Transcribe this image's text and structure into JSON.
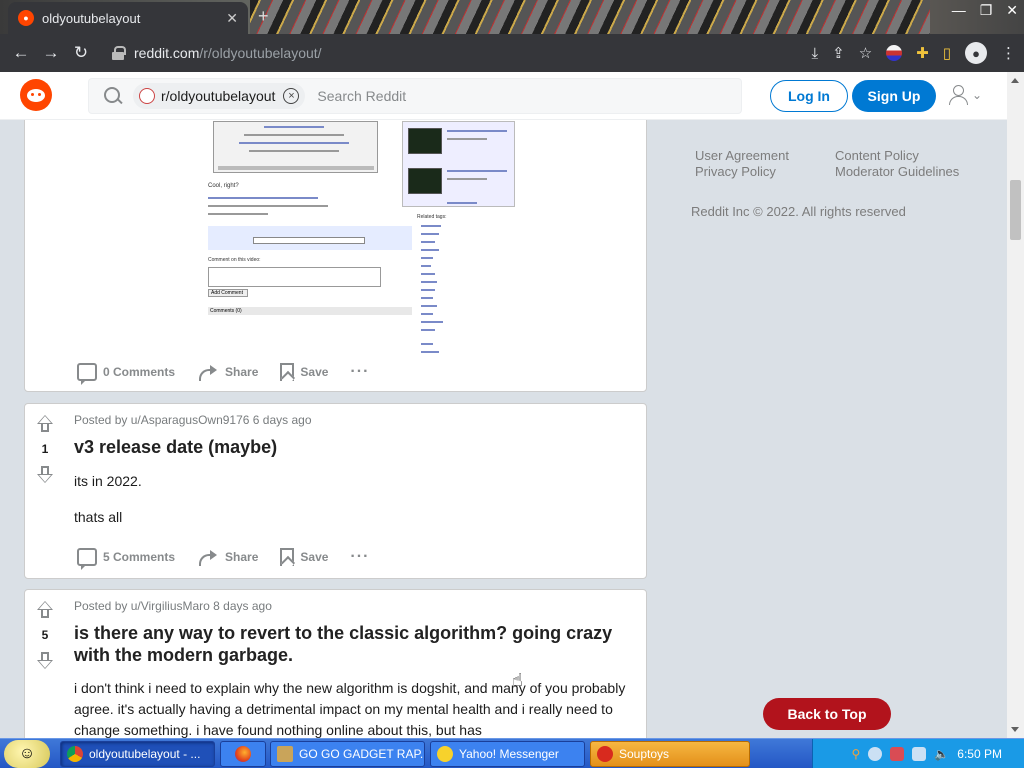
{
  "browser": {
    "tab_title": "oldyoutubelayout",
    "tab_close": "✕",
    "new_tab": "+",
    "url_host": "reddit.com",
    "url_path": "/r/oldyoutubelayout/",
    "nav": {
      "back": "←",
      "forward": "→",
      "reload": "↻"
    },
    "window": {
      "minimize": "—",
      "maximize": "❐",
      "close": "✕"
    },
    "toolbar_icons": {
      "install": "⤓",
      "share": "⇪",
      "bookmark": "☆",
      "extensions": "✚",
      "sidepanel": "▯",
      "menu": "⋮"
    }
  },
  "header": {
    "community_chip": "r/oldyoutubelayout",
    "chip_clear": "×",
    "search_placeholder": "Search Reddit",
    "login": "Log In",
    "signup": "Sign Up",
    "user_caret": "⌄"
  },
  "posts": [
    {
      "comments": "0 Comments",
      "share": "Share",
      "save": "Save",
      "more": "···",
      "screenshot_text": {
        "caption": "Cool, right?",
        "related_header": "Related tags:",
        "comment_label": "Comment on this video:",
        "add_comment": "Add Comment",
        "comments_label": "Comments (0)"
      }
    },
    {
      "score": "1",
      "meta": "Posted by u/AsparagusOwn9176 6 days ago",
      "title": "v3 release date (maybe)",
      "body": [
        "its in 2022.",
        "thats all"
      ],
      "comments": "5 Comments",
      "share": "Share",
      "save": "Save",
      "more": "···"
    },
    {
      "score": "5",
      "meta": "Posted by u/VirgiliusMaro 8 days ago",
      "title": "is there any way to revert to the classic algorithm? going crazy with the modern garbage.",
      "body": [
        "i don't think i need to explain why the new algorithm is dogshit, and many of you probably agree. it's actually having a detrimental impact on my mental health and i really need to change something. i have found nothing online about this, but has"
      ]
    }
  ],
  "sidebar": {
    "links": [
      [
        "User Agreement",
        "Privacy Policy"
      ],
      [
        "Content Policy",
        "Moderator Guidelines"
      ]
    ],
    "copyright": "Reddit Inc © 2022. All rights reserved",
    "back_to_top": "Back to Top"
  },
  "taskbar": {
    "items": [
      {
        "label": "oldyoutubelayout - ...",
        "icon": "chrome-icon"
      },
      {
        "label": "",
        "icon": "firefox-icon"
      },
      {
        "label": "GO GO GADGET RAP...",
        "icon": "folder-icon"
      },
      {
        "label": "Yahoo! Messenger",
        "icon": "messenger-icon"
      },
      {
        "label": "Souptoys",
        "icon": "souptoys-icon"
      }
    ],
    "clock": "6:50 PM"
  },
  "colors": {
    "reddit_orange": "#ff4500",
    "reddit_blue": "#0079d3",
    "back_to_top": "#b2131c",
    "page_bg": "#dae0e6"
  }
}
